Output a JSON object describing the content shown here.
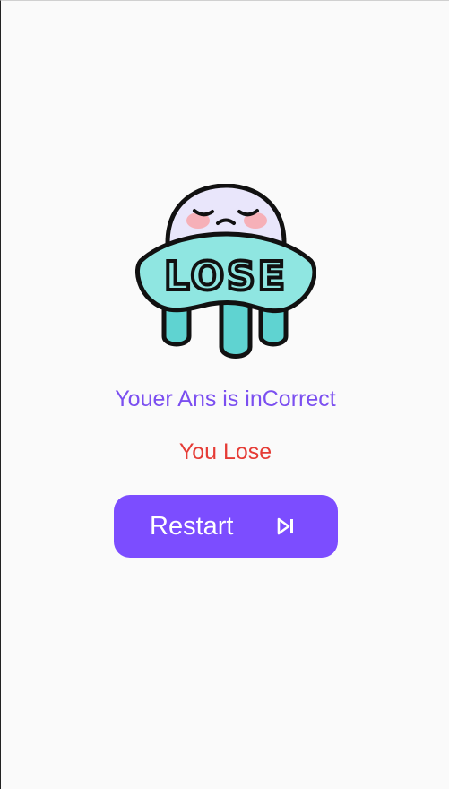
{
  "illustration": {
    "icon": "lose-ghost-illustration",
    "banner_text": "LOSE"
  },
  "result": {
    "message": "Youer Ans is inCorrect",
    "status": "You Lose"
  },
  "restart_button": {
    "label": "Restart",
    "icon": "skip-next-icon"
  },
  "colors": {
    "background": "#fafafa",
    "accent": "#7c4dff",
    "message": "#7b4ff0",
    "lose": "#e53b35"
  }
}
